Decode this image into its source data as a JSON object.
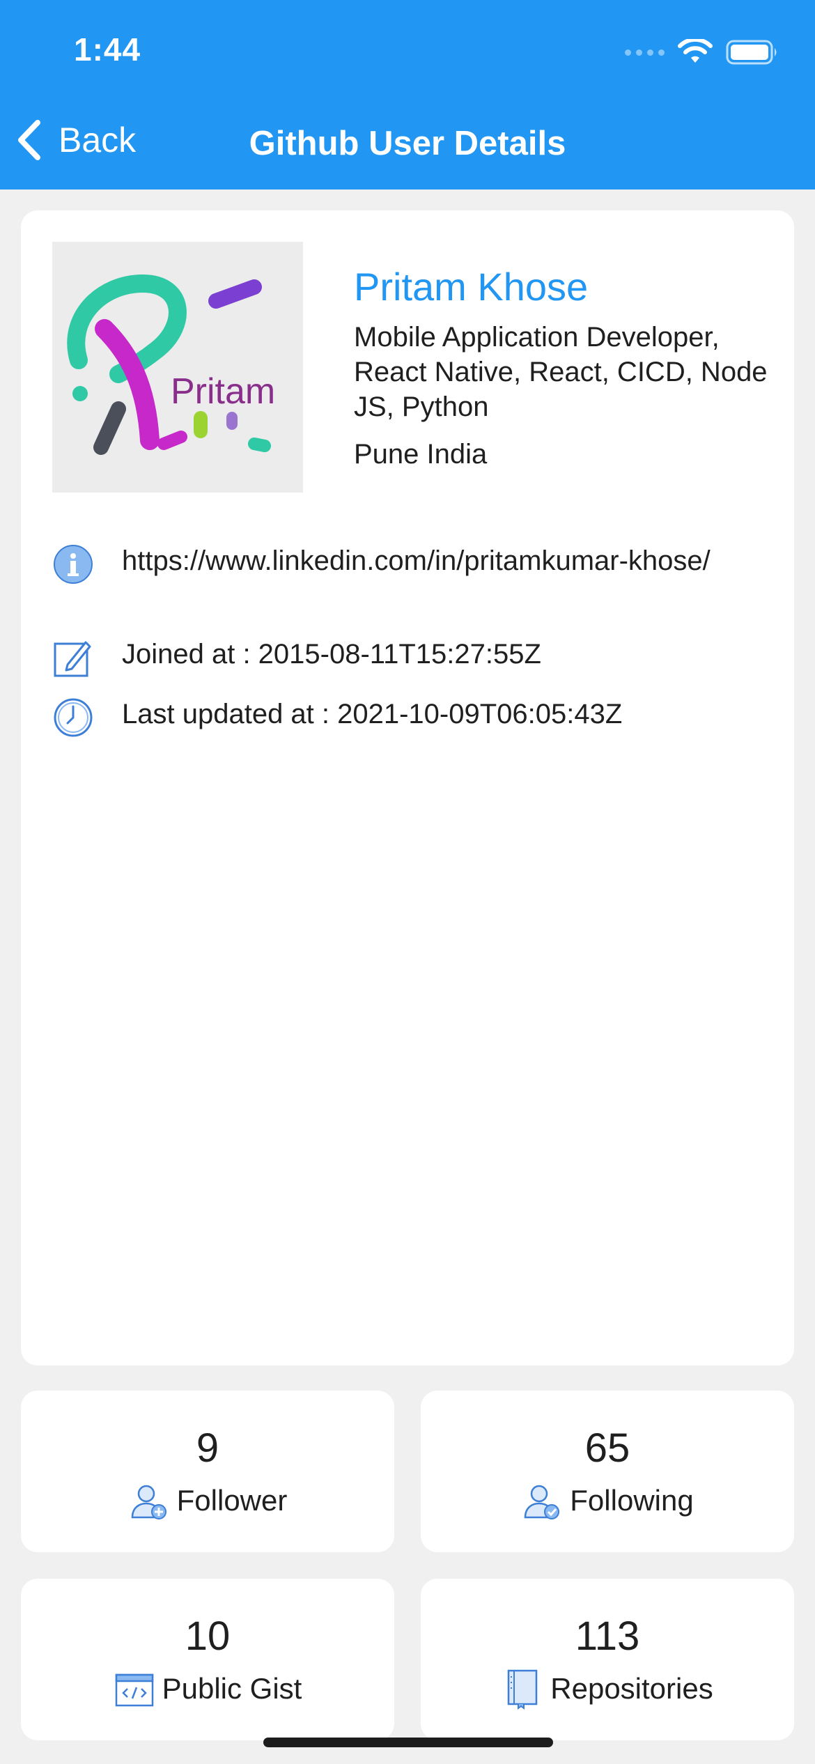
{
  "status_bar": {
    "time": "1:44"
  },
  "nav": {
    "back_label": "Back",
    "title": "Github User Details"
  },
  "profile": {
    "avatar_alt": "Pritam",
    "name": "Pritam Khose",
    "bio": "Mobile Application Developer, React Native, React, CICD, Node JS, Python",
    "location": "Pune India",
    "website": "https://www.linkedin.com/in/pritamkumar-khose/",
    "joined": "Joined at : 2015-08-11T15:27:55Z",
    "updated": "Last updated at : 2021-10-09T06:05:43Z"
  },
  "stats": {
    "followers": {
      "count": "9",
      "label": "Follower"
    },
    "following": {
      "count": "65",
      "label": "Following"
    },
    "gists": {
      "count": "10",
      "label": "Public Gist"
    },
    "repos": {
      "count": "113",
      "label": "Repositories"
    }
  },
  "colors": {
    "accent": "#2196f3",
    "background": "#f0f0f0",
    "card": "#ffffff"
  }
}
